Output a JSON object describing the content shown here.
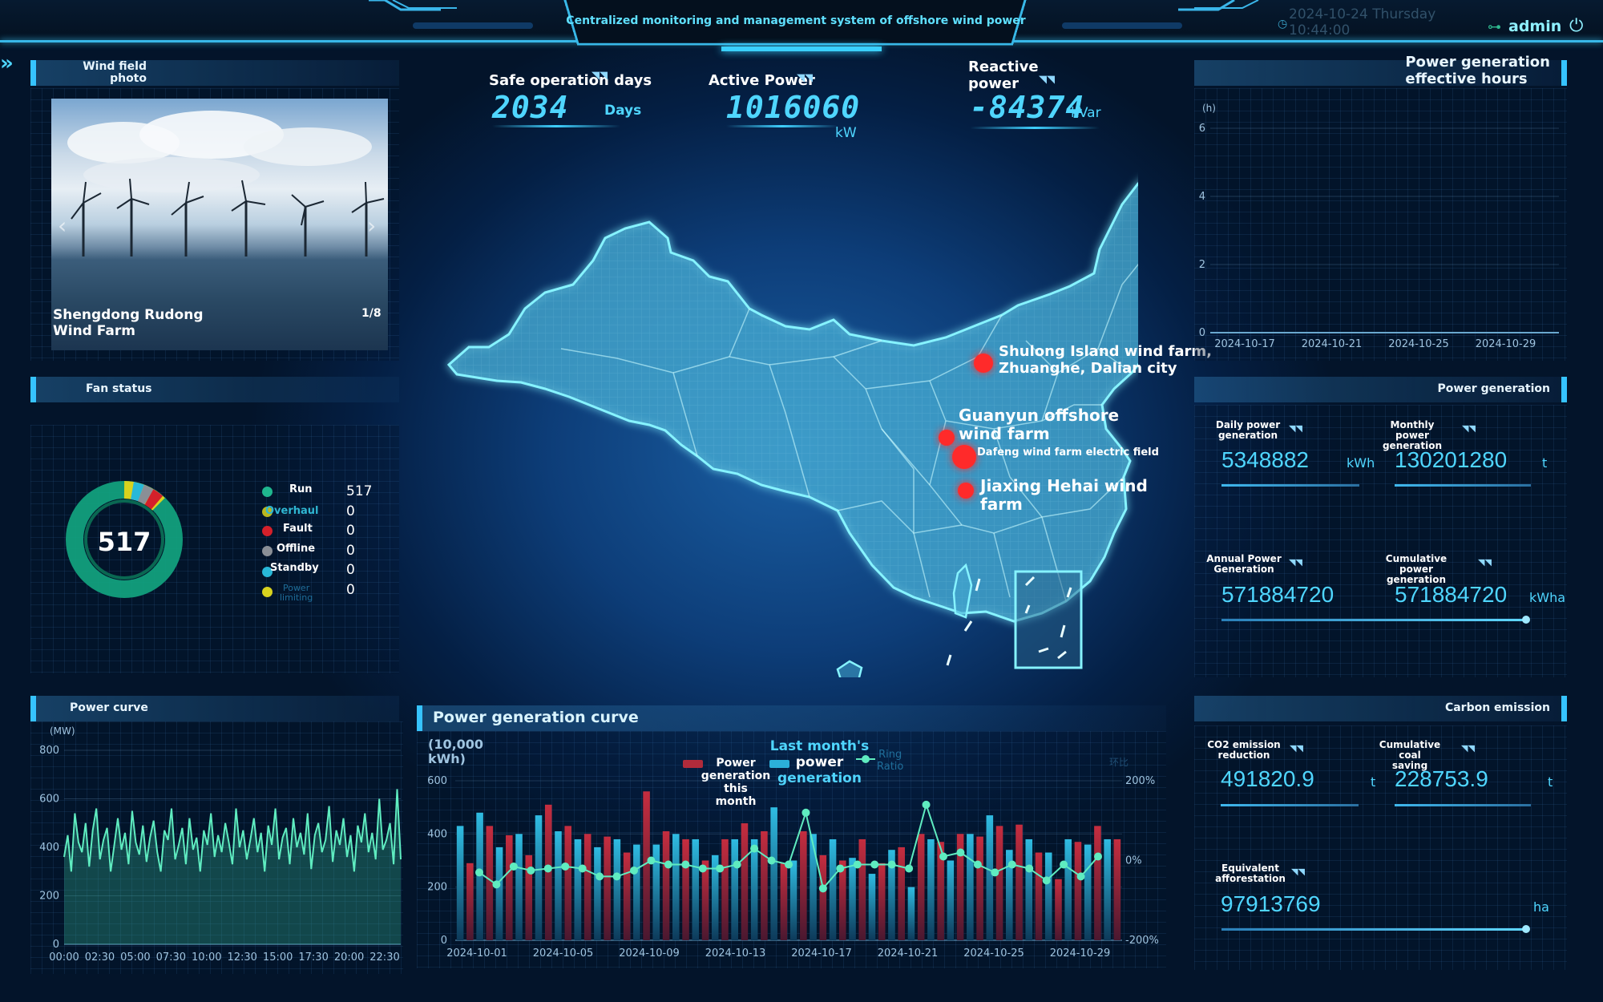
{
  "header": {
    "title": "Centralized monitoring and management system of offshore wind power",
    "datetime_line1": "2024-10-24 Thursday",
    "datetime_line2": "10:44:00",
    "user": "admin"
  },
  "wind_field": {
    "title_line1": "Wind field",
    "title_line2": "photo",
    "caption_line1": "Shengdong Rudong",
    "caption_line2": "Wind Farm",
    "counter": "1/8"
  },
  "stats": {
    "safe_days": {
      "label": "Safe operation days",
      "value": "2034",
      "unit": "Days"
    },
    "active_power": {
      "label": "Active Power",
      "value": "1016060",
      "unit": "kW"
    },
    "reactive_power": {
      "label_line1": "Reactive",
      "label_line2": "power",
      "value": "-84374",
      "unit": "kVar"
    }
  },
  "map": {
    "labels": [
      {
        "line1": "Shulong Island wind farm,",
        "line2": "Zhuanghe, Dalian city"
      },
      {
        "line1": "Guanyun offshore",
        "line2": "wind farm"
      },
      {
        "line1": "Dafeng wind farm electric field",
        "line2": ""
      },
      {
        "line1": "Jiaxing Hehai wind",
        "line2": "farm"
      }
    ]
  },
  "fan_status": {
    "title": "Fan status",
    "total": "517",
    "items": [
      {
        "label": "Run",
        "value": "517",
        "color": "#1fb68e"
      },
      {
        "label": "Overhaul",
        "value": "0",
        "color": "#b9b61e"
      },
      {
        "label": "Fault",
        "value": "0",
        "color": "#d4202a"
      },
      {
        "label": "Offline",
        "value": "0",
        "color": "#8a8f96"
      },
      {
        "label": "Standby",
        "value": "0",
        "color": "#28b8d8"
      },
      {
        "label_line1": "Power",
        "label_line2": "limiting",
        "value": "0",
        "color": "#d8d21e"
      }
    ]
  },
  "power_curve": {
    "title": "Power curve",
    "unit": "(MW)"
  },
  "gen_curve": {
    "title": "Power generation curve",
    "unit_line1": "(10,000",
    "unit_line2": "kWh)",
    "legend": {
      "this_month": [
        "Power",
        "generation this",
        "month"
      ],
      "last_month": [
        "Last month's",
        "power",
        "generation"
      ],
      "ratio": [
        "Ring",
        "Ratio"
      ],
      "ratio_axis_label": "环比"
    }
  },
  "eff_hours": {
    "title_line1": "Power generation",
    "title_line2": "effective hours",
    "unit": "(h)"
  },
  "power_generation": {
    "title": "Power generation",
    "items": [
      {
        "label_line1": "Daily power",
        "label_line2": "generation",
        "value": "5348882",
        "unit": "kWh"
      },
      {
        "label_line1": "Monthly power",
        "label_line2": "generation",
        "value": "130201280",
        "unit": "t"
      },
      {
        "label_line1": "Annual Power",
        "label_line2": "Generation",
        "value": "571884720",
        "unit": "kWh"
      },
      {
        "label_line1": "Cumulative power",
        "label_line2": "generation",
        "value": "571884720",
        "unit": "kWha"
      }
    ]
  },
  "carbon": {
    "title": "Carbon emission",
    "items": [
      {
        "label_line1": "CO2 emission",
        "label_line2": "reduction",
        "value": "491820.9",
        "unit": "t"
      },
      {
        "label_line1": "Cumulative coal",
        "label_line2": "saving",
        "value": "228753.9",
        "unit": "t"
      },
      {
        "label_line1": "Equivalent",
        "label_line2": "afforestation",
        "value": "97913769",
        "unit": "ha"
      }
    ]
  },
  "chart_data": [
    {
      "type": "area",
      "title": "Power curve",
      "ylabel": "(MW)",
      "ylim": [
        0,
        800
      ],
      "yticks": [
        "0",
        "200",
        "400",
        "600",
        "800"
      ],
      "x_tick_labels": [
        "00:00",
        "02:30",
        "05:00",
        "07:30",
        "10:00",
        "12:30",
        "15:00",
        "17:30",
        "20:00",
        "22:30"
      ],
      "values": [
        360,
        450,
        300,
        540,
        420,
        380,
        500,
        320,
        470,
        560,
        350,
        430,
        480,
        300,
        410,
        520,
        390,
        460,
        330,
        550,
        420,
        370,
        490,
        340,
        440,
        510,
        380,
        300,
        470,
        430,
        560,
        350,
        410,
        480,
        330,
        520,
        390,
        440,
        300,
        470,
        410,
        540,
        360,
        450,
        380,
        500,
        420,
        330,
        560,
        400,
        470,
        350,
        430,
        520,
        380,
        460,
        300,
        490,
        410,
        560,
        350,
        440,
        480,
        330,
        520,
        400,
        460,
        370,
        540,
        310,
        450,
        500,
        380,
        430,
        570,
        340,
        470,
        410,
        520,
        360,
        450,
        300,
        490,
        420,
        540,
        380,
        460,
        350,
        600,
        390,
        430,
        500,
        330,
        640,
        350
      ]
    },
    {
      "type": "bar",
      "title": "Power generation curve",
      "ylabel": "(10,000 kWh)",
      "ylim": [
        0,
        600
      ],
      "yticks": [
        "0",
        "200",
        "400",
        "600"
      ],
      "y2_ticks": [
        "-200%",
        "0%",
        "200%"
      ],
      "y2lim": [
        -200,
        200
      ],
      "x_tick_labels": [
        "2024-10-01",
        "2024-10-05",
        "2024-10-09",
        "2024-10-13",
        "2024-10-17",
        "2024-10-21",
        "2024-10-25",
        "2024-10-29"
      ],
      "series": [
        {
          "name": "Power generation this month",
          "values": [
            245,
            290,
            370,
            430,
            400,
            395,
            330,
            320,
            390,
            510,
            320,
            430,
            410,
            400,
            370,
            390,
            390,
            330,
            430,
            560,
            350,
            410,
            360,
            380,
            400,
            300,
            260,
            380,
            340,
            440,
            370,
            410,
            430,
            290,
            500,
            410,
            450,
            320,
            420,
            300,
            350,
            380,
            440,
            290,
            300,
            350,
            470,
            400,
            430,
            370,
            350,
            400,
            380,
            390,
            390,
            430,
            400,
            435,
            380,
            330,
            300,
            230,
            380,
            370,
            320,
            430,
            400,
            380
          ]
        },
        {
          "name": "Last month's power generation",
          "values": [
            430,
            300,
            480,
            400,
            350,
            350,
            400,
            380,
            470,
            370,
            410,
            350,
            380,
            350,
            350,
            320,
            380,
            300,
            360,
            440,
            360,
            470,
            400,
            390,
            380,
            420,
            320,
            350,
            380,
            410,
            380,
            400,
            500,
            380,
            300,
            350,
            400,
            380,
            380,
            380,
            310,
            380,
            250,
            330,
            340,
            380,
            200,
            400,
            380,
            300,
            300,
            380,
            400,
            320,
            470,
            380,
            340,
            300,
            380,
            390,
            330,
            320,
            380,
            430,
            360,
            380,
            380,
            380
          ]
        },
        {
          "name": "Ring Ratio",
          "values": [
            -30,
            -60,
            -15,
            -25,
            -20,
            -15,
            -20,
            -40,
            -40,
            -25,
            0,
            -10,
            -10,
            -20,
            -20,
            -10,
            30,
            0,
            -10,
            120,
            -70,
            -20,
            -10,
            -10,
            -10,
            -20,
            140,
            10,
            20,
            -10,
            -30,
            -10,
            -20,
            -50,
            -10,
            -40,
            10
          ]
        }
      ]
    },
    {
      "type": "line",
      "title": "Power generation effective hours",
      "ylabel": "(h)",
      "ylim": [
        0,
        6
      ],
      "yticks": [
        "0",
        "2",
        "4",
        "6"
      ],
      "x_tick_labels": [
        "2024-10-17",
        "2024-10-21",
        "2024-10-25",
        "2024-10-29"
      ]
    }
  ]
}
